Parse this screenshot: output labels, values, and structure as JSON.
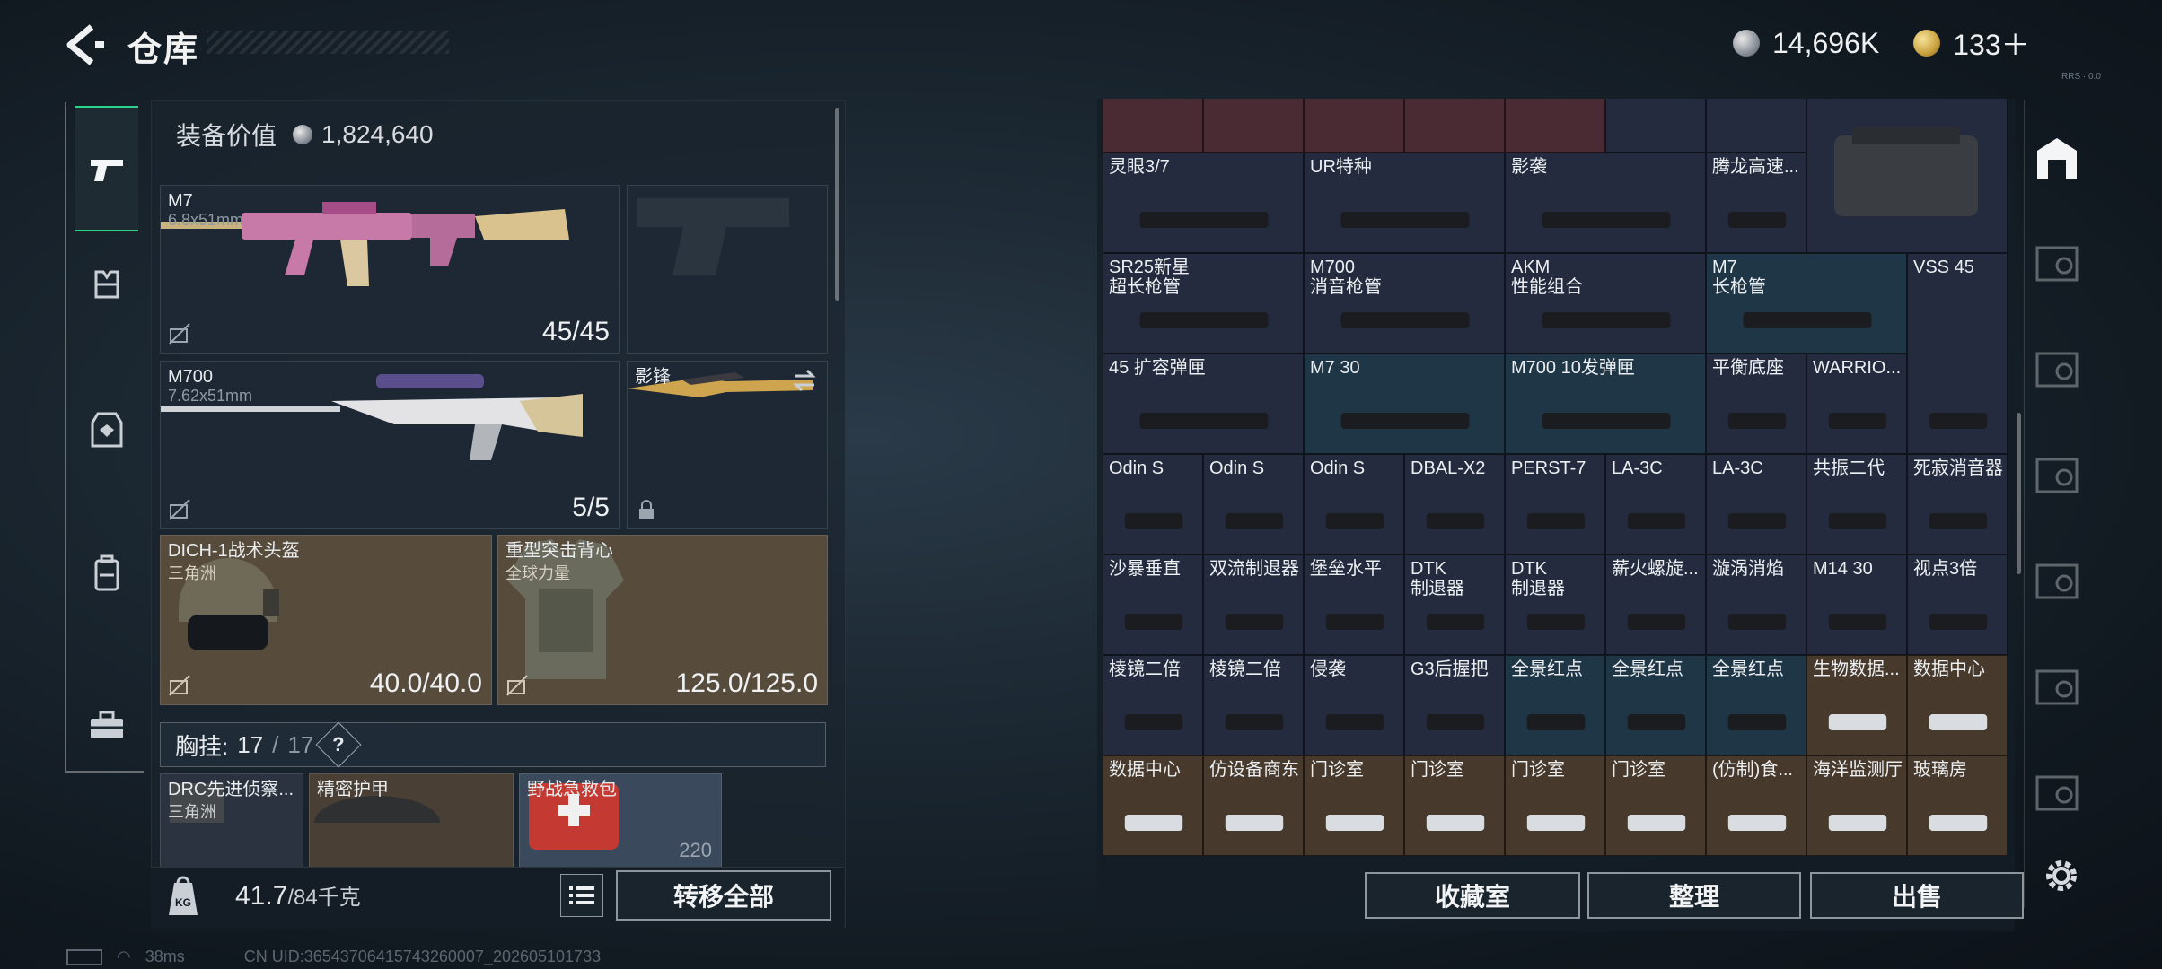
{
  "header": {
    "title": "仓库",
    "silver": "14,696K",
    "gold": "133＋",
    "hint": "RRS · 0.0"
  },
  "loadout": {
    "equip_value_label": "装备价值",
    "equip_value": "1,824,640",
    "primary": {
      "name": "M7",
      "caliber": "6.8x51mm",
      "ammo": "45/45"
    },
    "secondary": {
      "name": "M700",
      "caliber": "7.62x51mm",
      "ammo": "5/5"
    },
    "melee": {
      "name": "影锋"
    },
    "helmet": {
      "name": "DICH-1战术头盔",
      "sub": "三角洲",
      "durability": "40.0/40.0"
    },
    "armor": {
      "name": "重型突击背心",
      "sub": "全球力量",
      "durability": "125.0/125.0"
    },
    "vest": {
      "label": "胸挂:",
      "count": "17",
      "cap": "17",
      "help": "?"
    },
    "pouch": [
      {
        "name": "DRC先进侦察...",
        "sub": "三角洲"
      },
      {
        "name": "精密护甲",
        "sub": ""
      },
      {
        "name": "野战急救包",
        "sub": "",
        "val": "220"
      }
    ],
    "weight": "41.7",
    "weight_cap": "/84千克",
    "kg": "KG",
    "transfer_all": "转移全部"
  },
  "storage": {
    "top_partial": [
      "",
      "",
      "",
      "",
      "",
      "",
      "",
      "",
      ""
    ],
    "cells": [
      {
        "n": "灵眼3/7",
        "c": "n"
      },
      {
        "n": "UR特种",
        "c": "n"
      },
      {
        "n": "影袭",
        "c": "n"
      },
      {
        "n": "腾龙高速...",
        "c": "n"
      },
      {
        "n": "SR25新星\n超长枪管",
        "c": "n"
      },
      {
        "n": "M700\n消音枪管",
        "c": "n"
      },
      {
        "n": "AKM\n性能组合",
        "c": "n"
      },
      {
        "n": "M7\n长枪管",
        "c": "b"
      },
      {
        "n": "VSS 45",
        "c": "n"
      },
      {
        "n": "45 扩容弹匣",
        "c": "n"
      },
      {
        "n": "M7 30",
        "c": "b"
      },
      {
        "n": "M700 10发弹匣",
        "c": "b"
      },
      {
        "n": "平衡底座",
        "c": "n"
      },
      {
        "n": "WARRIO...",
        "c": "n"
      },
      {
        "n": "Odin S",
        "c": "n"
      },
      {
        "n": "Odin S",
        "c": "n"
      },
      {
        "n": "Odin S",
        "c": "n"
      },
      {
        "n": "DBAL-X2",
        "c": "n"
      },
      {
        "n": "PERST-7",
        "c": "n"
      },
      {
        "n": "LA-3C",
        "c": "n"
      },
      {
        "n": "LA-3C",
        "c": "n"
      },
      {
        "n": "共振二代",
        "c": "n"
      },
      {
        "n": "死寂消音器",
        "c": "n"
      },
      {
        "n": "沙暴垂直",
        "c": "n"
      },
      {
        "n": "双流制退器",
        "c": "n"
      },
      {
        "n": "堡垒水平",
        "c": "n"
      },
      {
        "n": "DTK\n制退器",
        "c": "n"
      },
      {
        "n": "DTK\n制退器",
        "c": "n"
      },
      {
        "n": "薪火螺旋...",
        "c": "n"
      },
      {
        "n": "漩涡消焰",
        "c": "n"
      },
      {
        "n": "M14 30",
        "c": "n"
      },
      {
        "n": "视点3倍",
        "c": "n"
      },
      {
        "n": "棱镜二倍",
        "c": "n"
      },
      {
        "n": "棱镜二倍",
        "c": "n"
      },
      {
        "n": "侵袭",
        "c": "n"
      },
      {
        "n": "G3后握把",
        "c": "n"
      },
      {
        "n": "全景红点",
        "c": "b"
      },
      {
        "n": "全景红点",
        "c": "b"
      },
      {
        "n": "全景红点",
        "c": "b"
      },
      {
        "n": "生物数据...",
        "c": "o"
      },
      {
        "n": "数据中心",
        "c": "o"
      },
      {
        "n": "数据中心",
        "c": "o"
      },
      {
        "n": "仿设备商东",
        "c": "o"
      },
      {
        "n": "门诊室",
        "c": "o"
      },
      {
        "n": "门诊室",
        "c": "o"
      },
      {
        "n": "门诊室",
        "c": "o"
      },
      {
        "n": "门诊室",
        "c": "o"
      },
      {
        "n": "(仿制)食...",
        "c": "o"
      },
      {
        "n": "海洋监测厅",
        "c": "o"
      },
      {
        "n": "玻璃房",
        "c": "o"
      }
    ],
    "btn_collection": "收藏室",
    "btn_sort": "整理",
    "btn_sell": "出售"
  },
  "status": {
    "ping": "38ms",
    "uid": "CN UID:36543706415743260007_202605101733"
  },
  "colors": {
    "accent": "#2ad58a",
    "panel": "#1d2834",
    "button_border": "#8e969d"
  }
}
